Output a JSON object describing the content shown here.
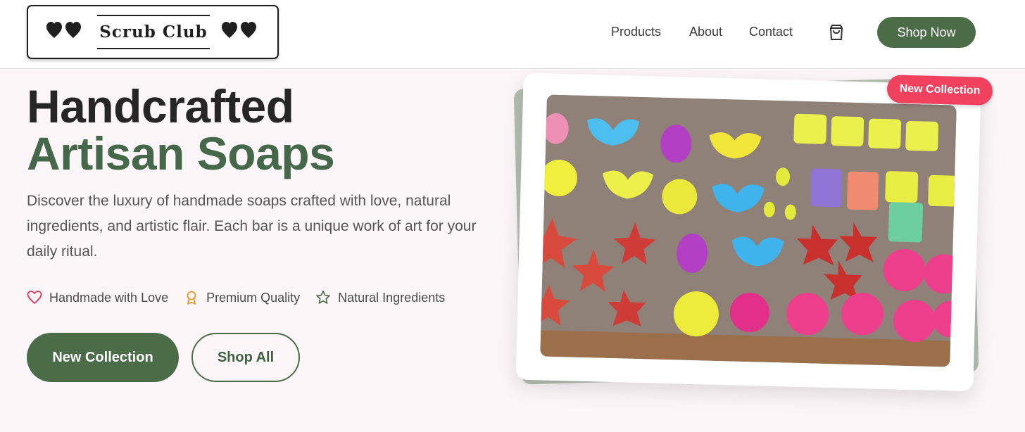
{
  "brand": {
    "name": "Scrub Club"
  },
  "nav": {
    "items": [
      {
        "label": "Products"
      },
      {
        "label": "About"
      },
      {
        "label": "Contact"
      }
    ],
    "cta_label": "Shop Now"
  },
  "hero": {
    "title_line1": "Handcrafted",
    "title_line2": "Artisan Soaps",
    "description": "Discover the luxury of handmade soaps crafted with love, natural ingredients, and artistic flair. Each bar is a unique work of art for your daily ritual.",
    "features": [
      {
        "label": "Handmade with Love",
        "icon": "heart-icon"
      },
      {
        "label": "Premium Quality",
        "icon": "award-icon"
      },
      {
        "label": "Natural Ingredients",
        "icon": "star-icon"
      }
    ],
    "primary_button": "New Collection",
    "secondary_button": "Shop All",
    "image_badge": "New Collection"
  },
  "colors": {
    "brand_green": "#4a6d48",
    "badge_pink": "#f0425f",
    "heart_red": "#e0385a",
    "award_orange": "#e89a2c"
  }
}
